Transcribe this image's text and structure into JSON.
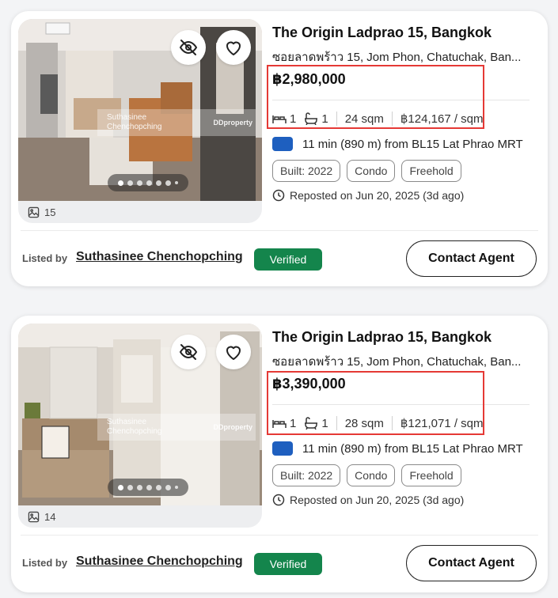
{
  "listings": [
    {
      "title": "The Origin Ladprao 15, Bangkok",
      "address": "ซอยลาดพร้าว 15, Jom Phon, Chatuchak, Ban...",
      "price": "฿2,980,000",
      "beds": "1",
      "baths": "1",
      "size": "24 sqm",
      "price_per_sqm": "฿124,167 / sqm",
      "mrt": "11 min (890 m) from BL15 Lat Phrao MRT",
      "tags": [
        "Built: 2022",
        "Condo",
        "Freehold"
      ],
      "reposted": "Reposted on Jun 20, 2025 (3d ago)",
      "photo_count": "15",
      "watermark_name": "Suthasinee Chenchopching",
      "watermark_logo": "DDproperty",
      "listed_by_label": "Listed by",
      "agent_name": "Suthasinee Chenchopching",
      "verified_label": "Verified",
      "contact_label": "Contact Agent"
    },
    {
      "title": "The Origin Ladprao 15, Bangkok",
      "address": "ซอยลาดพร้าว 15, Jom Phon, Chatuchak, Ban...",
      "price": "฿3,390,000",
      "beds": "1",
      "baths": "1",
      "size": "28 sqm",
      "price_per_sqm": "฿121,071 / sqm",
      "mrt": "11 min (890 m) from BL15 Lat Phrao MRT",
      "tags": [
        "Built: 2022",
        "Condo",
        "Freehold"
      ],
      "reposted": "Reposted on Jun 20, 2025 (3d ago)",
      "photo_count": "14",
      "watermark_name": "Suthasinee Chenchopching",
      "watermark_logo": "DDproperty",
      "listed_by_label": "Listed by",
      "agent_name": "Suthasinee Chenchopching",
      "verified_label": "Verified",
      "contact_label": "Contact Agent"
    }
  ],
  "colors": {
    "verified_bg": "#14854c",
    "mrt_icon": "#1e5fbf",
    "highlight_border": "#e53935"
  },
  "icons": {
    "hide": "eye-off-icon",
    "favorite": "heart-icon",
    "bed": "bed-icon",
    "bath": "bathtub-icon",
    "photos": "image-icon",
    "clock": "clock-icon",
    "mrt": "mrt-line-icon"
  }
}
